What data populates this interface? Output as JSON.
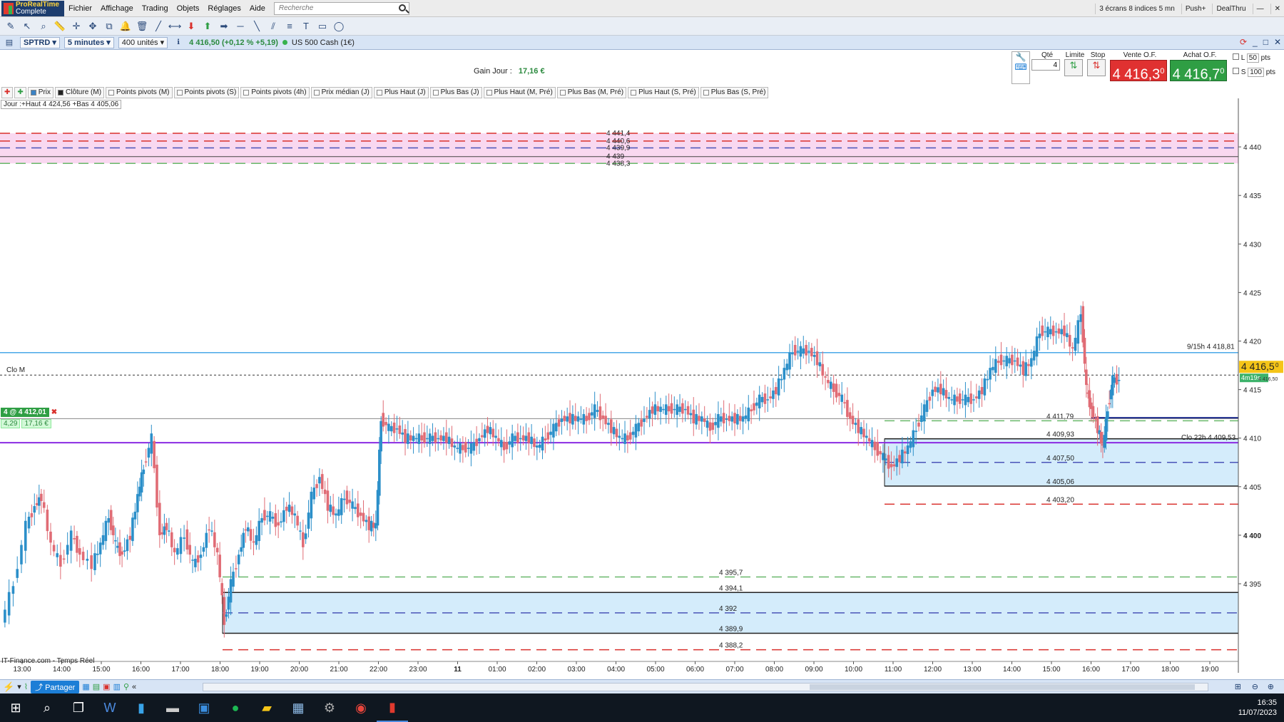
{
  "menubar": {
    "logo_top": "ProRealTime",
    "logo_bottom": "Complete",
    "items": [
      "Fichier",
      "Affichage",
      "Trading",
      "Objets",
      "Réglages",
      "Aide"
    ],
    "search_placeholder": "Recherche",
    "right_chips": [
      "3 écrans 8 indices 5 mn",
      "Push+",
      "DealThru"
    ]
  },
  "instrument": {
    "symbol": "SPTRD",
    "timeframe": "5 minutes",
    "units": "400 unités",
    "price_change": "4 416,50 (+0,12 % +5,19)",
    "name": "US 500 Cash (1€)"
  },
  "order_panel": {
    "gain_label": "Gain Jour :",
    "gain_value": "17,16 €",
    "qty_label": "Qté",
    "qty_value": "4",
    "limit_label": "Limite",
    "stop_label": "Stop",
    "sell_label": "Vente O.F.",
    "buy_label": "Achat O.F.",
    "sell_price": "4 416,3",
    "sell_sup": "0",
    "buy_price": "4 416,7",
    "buy_sup": "0",
    "l_label": "L",
    "l_value": "50",
    "s_label": "S",
    "s_value": "100",
    "pts": "pts"
  },
  "indicators": [
    "Prix",
    "Clôture (M)",
    "Points pivots (M)",
    "Points pivots (S)",
    "Points pivots (4h)",
    "Prix médian (J)",
    "Plus Haut (J)",
    "Plus Bas (J)",
    "Plus Haut (M, Pré)",
    "Plus Bas (M, Pré)",
    "Plus Haut (S, Pré)",
    "Plus Bas (S, Pré)"
  ],
  "day_info": "Jour :+Haut 4 424,56 +Bas 4 405,06",
  "position": {
    "label": "4 @ 4 412,01",
    "pnl_pts": "4,29",
    "pnl_eur": "17,16 €"
  },
  "source_label": "IT-Finance.com - Temps Réel",
  "chart_data": {
    "type": "candlestick",
    "ylim": [
      4387,
      4445
    ],
    "y_ticks": [
      "4 440",
      "4 435",
      "4 430",
      "4 425",
      "4 420",
      "4 415",
      "4 410",
      "4 405",
      "4 400",
      "4 395"
    ],
    "x_ticks": [
      "13:00",
      "14:00",
      "15:00",
      "16:00",
      "17:00",
      "18:00",
      "19:00",
      "20:00",
      "21:00",
      "22:00",
      "23:00",
      "11",
      "01:00",
      "02:00",
      "03:00",
      "04:00",
      "05:00",
      "06:00",
      "07:00",
      "08:00",
      "09:00",
      "10:00",
      "11:00",
      "12:00",
      "13:00",
      "14:00",
      "15:00",
      "16:00",
      "17:00",
      "18:00",
      "19:00"
    ],
    "last_price": "4 416,5",
    "last_price_sup": "0",
    "countdown": "4m19s",
    "countdown_sub": "4 416,50",
    "top_levels": [
      "4 441,4",
      "4 440,6",
      "4 439,9",
      "4 439",
      "4 438,3"
    ],
    "lower_levels": [
      "4 395,7",
      "4 394,1",
      "4 392",
      "4 389,9",
      "4 388,2"
    ],
    "right_levels": [
      "4 411,79",
      "4 409,93",
      "4 407,50",
      "4 405,06",
      "4 403,20"
    ],
    "annotations": {
      "clo_m": "Clo M",
      "hline_label": "9/15h 4 418,81",
      "clo22": "Clo 22h 4 409,53"
    },
    "path_points": [
      [
        0,
        4391
      ],
      [
        15,
        4395
      ],
      [
        30,
        4401
      ],
      [
        40,
        4403
      ],
      [
        48,
        4404
      ],
      [
        60,
        4399
      ],
      [
        72,
        4397
      ],
      [
        85,
        4400
      ],
      [
        95,
        4398
      ],
      [
        110,
        4397
      ],
      [
        120,
        4399
      ],
      [
        130,
        4402
      ],
      [
        138,
        4399
      ],
      [
        146,
        4398
      ],
      [
        156,
        4400
      ],
      [
        165,
        4404
      ],
      [
        172,
        4407
      ],
      [
        182,
        4410
      ],
      [
        192,
        4400
      ],
      [
        200,
        4401
      ],
      [
        210,
        4398
      ],
      [
        222,
        4400
      ],
      [
        232,
        4397
      ],
      [
        242,
        4398
      ],
      [
        252,
        4401
      ],
      [
        262,
        4398
      ],
      [
        270,
        4391
      ],
      [
        278,
        4395
      ],
      [
        288,
        4398
      ],
      [
        296,
        4401
      ],
      [
        306,
        4399
      ],
      [
        316,
        4402
      ],
      [
        326,
        4402
      ],
      [
        336,
        4401
      ],
      [
        346,
        4403
      ],
      [
        356,
        4402
      ],
      [
        366,
        4399
      ],
      [
        376,
        4404
      ],
      [
        386,
        4406
      ],
      [
        396,
        4403
      ],
      [
        406,
        4402
      ],
      [
        416,
        4404
      ],
      [
        426,
        4403
      ],
      [
        436,
        4402
      ],
      [
        446,
        4401
      ],
      [
        454,
        4401
      ],
      [
        460,
        4412
      ],
      [
        470,
        4411
      ],
      [
        480,
        4411
      ],
      [
        490,
        4410
      ],
      [
        500,
        4410
      ],
      [
        510,
        4410
      ],
      [
        520,
        4410
      ],
      [
        530,
        4410
      ],
      [
        540,
        4410
      ],
      [
        550,
        4409
      ],
      [
        560,
        4409
      ],
      [
        570,
        4409
      ],
      [
        580,
        4410
      ],
      [
        590,
        4411
      ],
      [
        600,
        4410
      ],
      [
        610,
        4409
      ],
      [
        620,
        4410
      ],
      [
        630,
        4410
      ],
      [
        640,
        4410
      ],
      [
        650,
        4409
      ],
      [
        660,
        4410
      ],
      [
        670,
        4411
      ],
      [
        680,
        4412
      ],
      [
        690,
        4412
      ],
      [
        700,
        4412
      ],
      [
        710,
        4412
      ],
      [
        720,
        4413
      ],
      [
        730,
        4412
      ],
      [
        740,
        4411
      ],
      [
        750,
        4410
      ],
      [
        760,
        4410
      ],
      [
        770,
        4411
      ],
      [
        780,
        4412
      ],
      [
        790,
        4413
      ],
      [
        800,
        4413
      ],
      [
        810,
        4413
      ],
      [
        820,
        4413
      ],
      [
        830,
        4413
      ],
      [
        840,
        4412
      ],
      [
        850,
        4412
      ],
      [
        860,
        4411
      ],
      [
        870,
        4412
      ],
      [
        880,
        4412
      ],
      [
        890,
        4412
      ],
      [
        900,
        4412
      ],
      [
        910,
        4413
      ],
      [
        920,
        4414
      ],
      [
        930,
        4414
      ],
      [
        940,
        4415
      ],
      [
        950,
        4417
      ],
      [
        960,
        4419
      ],
      [
        970,
        4419
      ],
      [
        980,
        4419
      ],
      [
        990,
        4418
      ],
      [
        1000,
        4416
      ],
      [
        1010,
        4415
      ],
      [
        1020,
        4414
      ],
      [
        1030,
        4412
      ],
      [
        1040,
        4411
      ],
      [
        1050,
        4410
      ],
      [
        1060,
        4409
      ],
      [
        1070,
        4408
      ],
      [
        1080,
        4407
      ],
      [
        1090,
        4408
      ],
      [
        1100,
        4409
      ],
      [
        1110,
        4411
      ],
      [
        1120,
        4413
      ],
      [
        1130,
        4415
      ],
      [
        1140,
        4415
      ],
      [
        1150,
        4414
      ],
      [
        1160,
        4414
      ],
      [
        1170,
        4414
      ],
      [
        1180,
        4414
      ],
      [
        1190,
        4415
      ],
      [
        1200,
        4417
      ],
      [
        1210,
        4418
      ],
      [
        1220,
        4418
      ],
      [
        1230,
        4418
      ],
      [
        1240,
        4417
      ],
      [
        1250,
        4418
      ],
      [
        1260,
        4421
      ],
      [
        1270,
        4421
      ],
      [
        1280,
        4421
      ],
      [
        1290,
        4421
      ],
      [
        1300,
        4419
      ],
      [
        1310,
        4423
      ],
      [
        1316,
        4415
      ],
      [
        1322,
        4413
      ],
      [
        1330,
        4411
      ],
      [
        1336,
        4409
      ],
      [
        1342,
        4413
      ],
      [
        1348,
        4416
      ],
      [
        1356,
        4416
      ]
    ]
  },
  "bottombar": {
    "share_label": "Partager"
  },
  "taskbar": {
    "time": "16:35",
    "date": "11/07/2023"
  },
  "colors": {
    "up": "#2b8fc9",
    "down": "#e06c75",
    "red_dash": "#d9302c",
    "green_dash": "#69b86a",
    "blue_line": "#4aa8e8",
    "purple_line": "#8a2be2",
    "zone_fill": "#d4ecfb",
    "pink_fill": "#f7c7ea",
    "last_price_bg": "#f5c518"
  }
}
